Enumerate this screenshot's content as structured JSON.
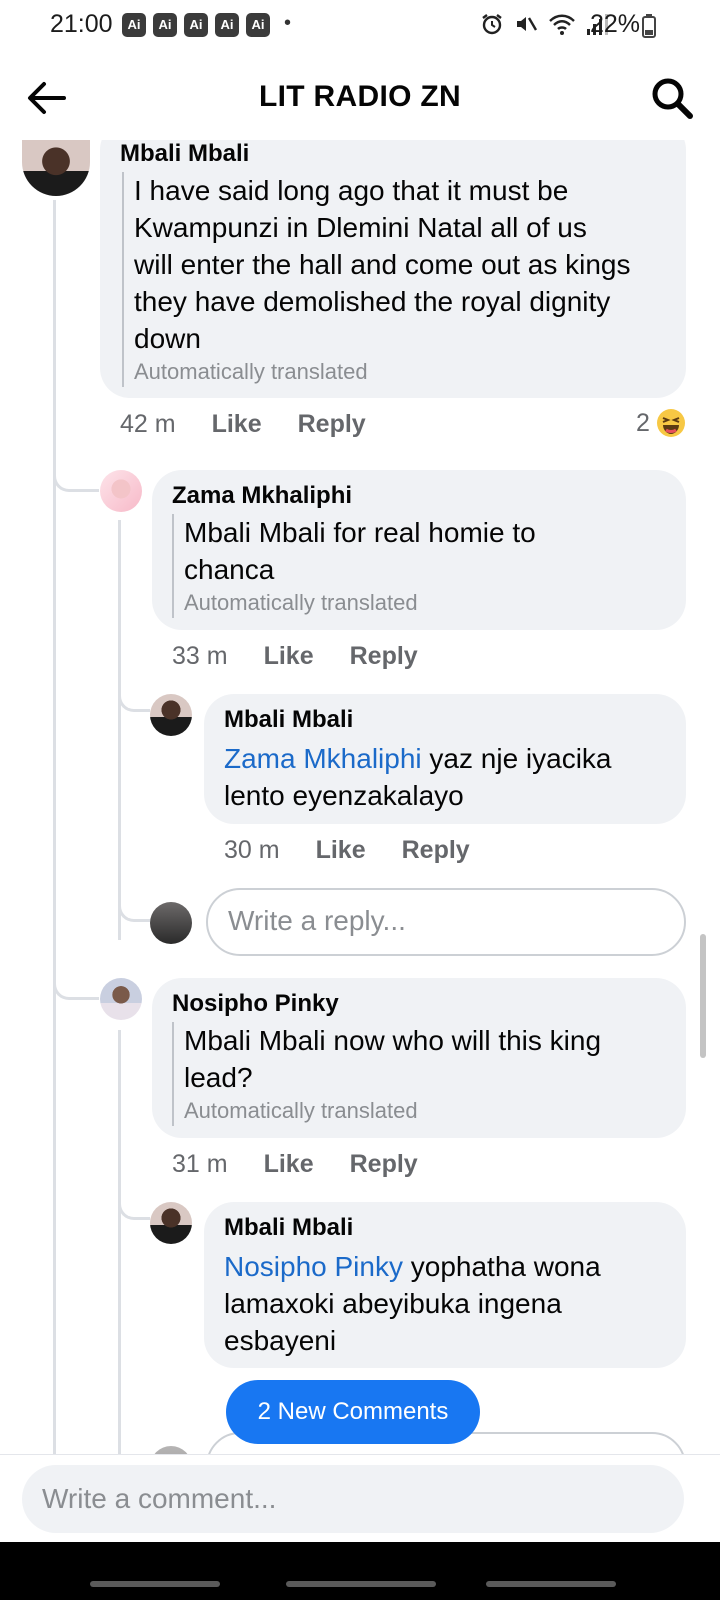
{
  "status_bar": {
    "time": "21:00",
    "ai_badges": [
      "Ai",
      "Ai",
      "Ai",
      "Ai",
      "Ai"
    ],
    "dot": "•",
    "battery": "22%",
    "icons": [
      "alarm-icon",
      "mute-icon",
      "wifi-icon",
      "signal-icon",
      "battery-icon"
    ]
  },
  "header": {
    "title": "LIT RADIO ZN",
    "back_icon": "back-arrow-icon",
    "search_icon": "search-icon"
  },
  "comments": [
    {
      "author": "Mbali Mbali",
      "lines": [
        "I have said long ago that it must be",
        "Kwampunzi in Dlemini Natal all of us",
        "will enter the hall and come out as kings",
        "they have demolished the royal dignity",
        "down"
      ],
      "translated_note": "Automatically translated",
      "time": "42 m",
      "like": "Like",
      "reply": "Reply",
      "reaction_count": "2",
      "reaction_icon": "haha-reaction-icon"
    },
    {
      "author": "Zama Mkhaliphi",
      "lines": [
        "Mbali Mbali for real homie to",
        "chanca"
      ],
      "translated_note": "Automatically translated",
      "time": "33 m",
      "like": "Like",
      "reply": "Reply"
    },
    {
      "author": "Mbali Mbali",
      "mention": "Zama Mkhaliphi",
      "first_line_rest": " yaz nje iyacika",
      "lines_after": [
        "lento eyenzakalayo"
      ],
      "time": "30 m",
      "like": "Like",
      "reply": "Reply"
    },
    {
      "author": "Nosipho Pinky",
      "lines": [
        "Mbali Mbali now who will this king",
        "lead?"
      ],
      "translated_note": "Automatically translated",
      "time": "31 m",
      "like": "Like",
      "reply": "Reply"
    },
    {
      "author": "Mbali Mbali",
      "mention": "Nosipho Pinky",
      "first_line_rest": " yophatha wona",
      "lines_after": [
        "lamaxoki abeyibuka ingena",
        "esbayeni"
      ]
    }
  ],
  "reply_input": {
    "placeholder": "Write a reply..."
  },
  "new_comments_button": "2 New Comments",
  "comment_input": {
    "placeholder": "Write a comment..."
  },
  "colors": {
    "accent": "#1877f2",
    "mention": "#1b6ac9",
    "bubble": "#f0f2f5",
    "muted_text": "#65676b"
  }
}
